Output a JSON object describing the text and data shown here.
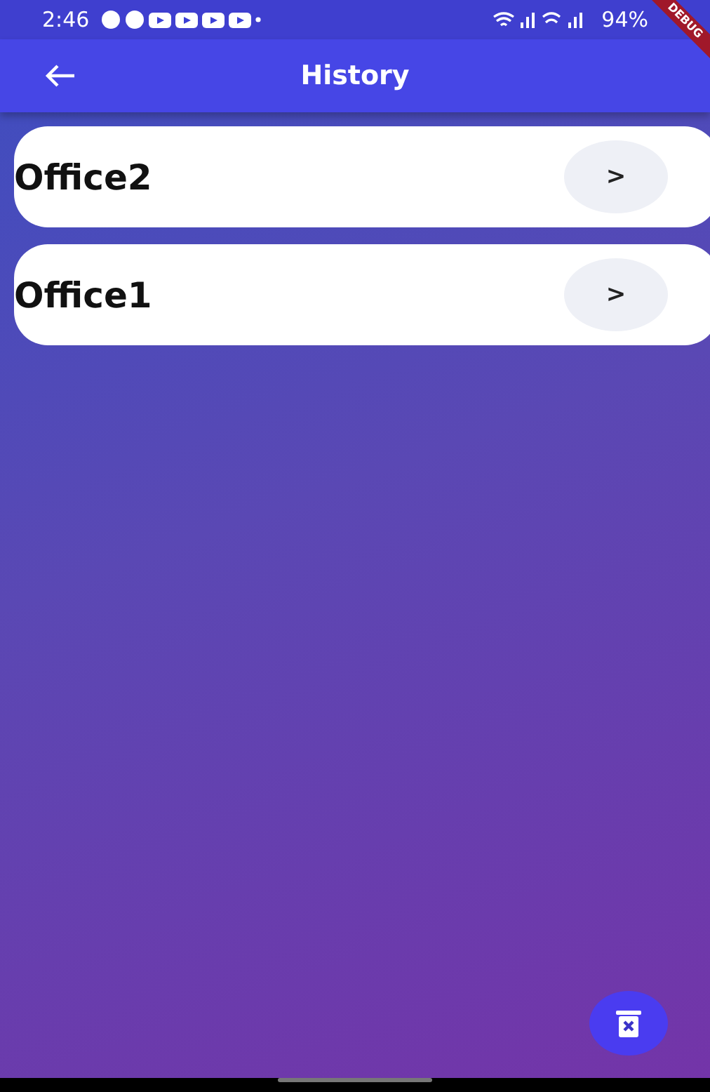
{
  "status_bar": {
    "time": "2:46",
    "battery": "94%"
  },
  "debug_banner": "DEBUG",
  "app_bar": {
    "title": "History"
  },
  "items": [
    {
      "name": "Office2",
      "button": ">"
    },
    {
      "name": "Office1",
      "button": ">"
    }
  ]
}
